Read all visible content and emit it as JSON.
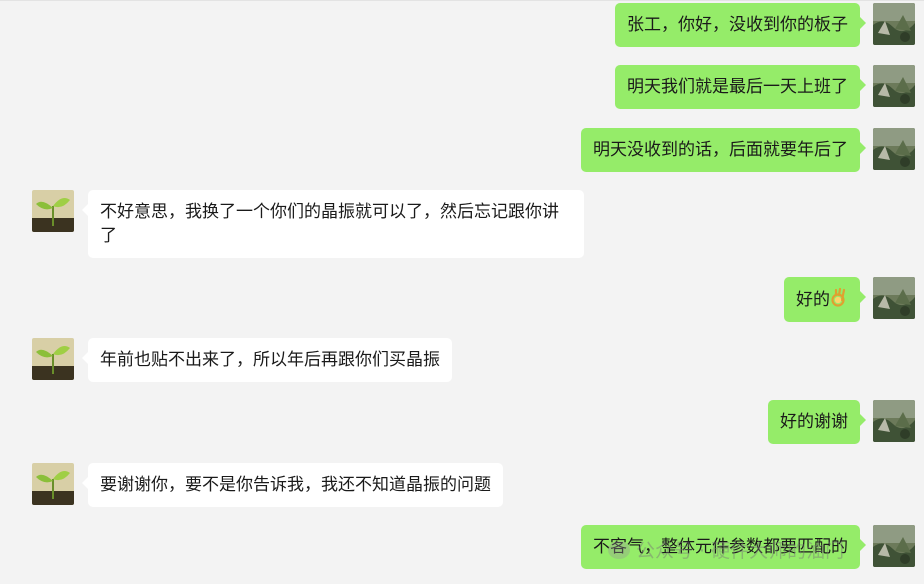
{
  "messages": [
    {
      "side": "me",
      "text": "张工，你好，没收到你的板子"
    },
    {
      "side": "me",
      "text": "明天我们就是最后一天上班了"
    },
    {
      "side": "me",
      "text": "明天没收到的话，后面就要年后了"
    },
    {
      "side": "other",
      "text": "不好意思，我换了一个你们的晶振就可以了，然后忘记跟你讲了"
    },
    {
      "side": "me",
      "text": "好的",
      "emoji": "ok-hand-icon"
    },
    {
      "side": "other",
      "text": "年前也贴不出来了，所以年后再跟你们买晶振"
    },
    {
      "side": "me",
      "text": "好的谢谢"
    },
    {
      "side": "other",
      "text": "要谢谢你，要不是你告诉我，我还不知道晶振的问题"
    },
    {
      "side": "me",
      "text": "不客气，整体元件参数都要匹配的"
    }
  ],
  "watermark": {
    "text": "公众号 · 硬件大师的油门"
  },
  "colors": {
    "me_bubble": "#95ec69",
    "other_bubble": "#ffffff",
    "background": "#f3f3f3"
  }
}
